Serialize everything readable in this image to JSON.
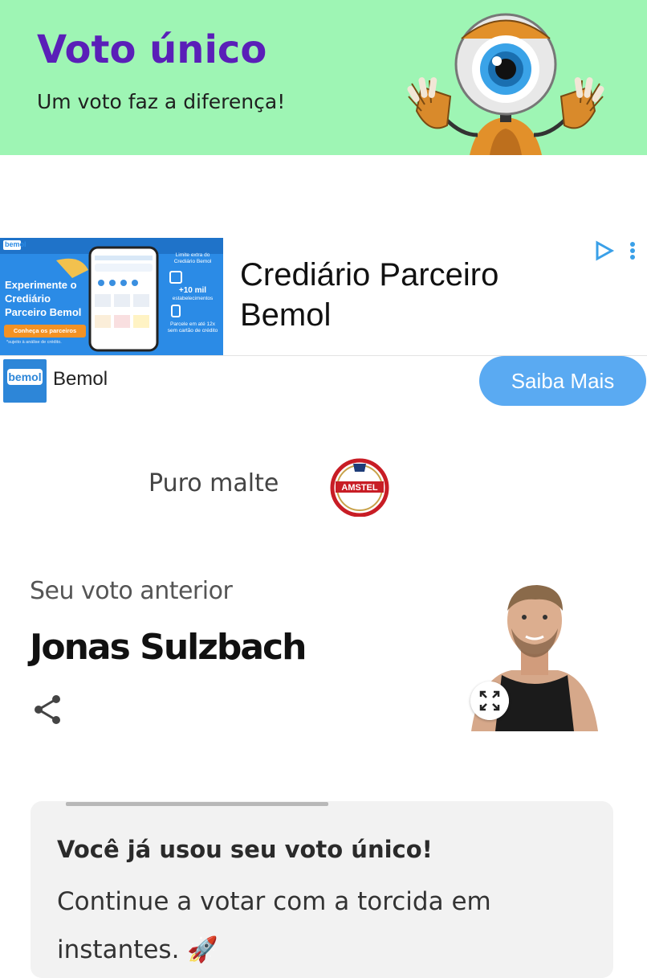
{
  "header": {
    "title": "Voto único",
    "subtitle": "Um voto faz a diferença!",
    "background_color": "#9ef5b4",
    "title_color": "#5a1fb8",
    "mascot_icon": "eye-mascot-icon"
  },
  "ad": {
    "banner": {
      "logo_text": "bemol",
      "headline": "Experimente o Crediário Parceiro Bemol",
      "button_label": "Conheça os parceiros",
      "footnote": "*sujeito à análise de crédito.",
      "info_1": "Limite extra do Crediário Bemol",
      "info_2": "+10 mil",
      "info_2_sub": "estabelecimentos",
      "info_3": "Parcele em até 12x sem cartão de crédito"
    },
    "title": "Crediário Parceiro Bemol",
    "advertiser_logo_text": "bemol",
    "advertiser_name": "Bemol",
    "cta_label": "Saiba Mais",
    "cta_color": "#5aaaf2",
    "choices_icon": "ad-choices-icon"
  },
  "sponsor": {
    "text": "Puro malte",
    "logo_text": "AMSTEL"
  },
  "previous_vote": {
    "label": "Seu voto anterior",
    "name": "Jonas Sulzbach",
    "share_icon": "share-icon",
    "expand_icon": "expand-icon"
  },
  "notice": {
    "title": "Você já usou seu voto único!",
    "text": "Continue a votar com a torcida em instantes. 🚀"
  }
}
